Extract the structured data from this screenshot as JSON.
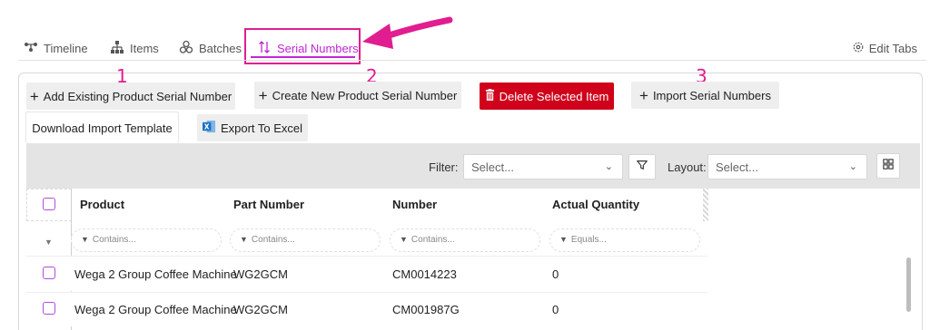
{
  "tabs": {
    "items": [
      {
        "label": "Timeline",
        "icon": "timeline-icon"
      },
      {
        "label": "Items",
        "icon": "hierarchy-icon"
      },
      {
        "label": "Batches",
        "icon": "batches-icon"
      },
      {
        "label": "Serial Numbers",
        "icon": "sort-icon"
      }
    ],
    "edit_label": "Edit Tabs"
  },
  "callouts": [
    "1",
    "2",
    "3"
  ],
  "toolbar": {
    "add_existing": "Add Existing Product Serial Number",
    "create_new": "Create New Product Serial Number",
    "delete_selected": "Delete Selected Item",
    "import_serials": "Import Serial Numbers",
    "download_template": "Download Import Template",
    "export_excel": "Export To Excel"
  },
  "grid_toolbar": {
    "filter_label": "Filter:",
    "filter_value": "Select...",
    "layout_label": "Layout:",
    "layout_value": "Select..."
  },
  "table": {
    "columns": [
      "Product",
      "Part Number",
      "Number",
      "Actual Quantity"
    ],
    "filters": [
      "Contains...",
      "Contains...",
      "Contains...",
      "Equals..."
    ],
    "rows": [
      {
        "product": "Wega 2 Group Coffee Machine",
        "part": "WG2GCM",
        "number": "CM0014223",
        "qty": "0"
      },
      {
        "product": "Wega 2 Group Coffee Machine",
        "part": "WG2GCM",
        "number": "CM001987G",
        "qty": "0"
      }
    ]
  },
  "colors": {
    "accent": "#c026d3",
    "highlight": "#e11d8f",
    "danger": "#d0021b"
  }
}
